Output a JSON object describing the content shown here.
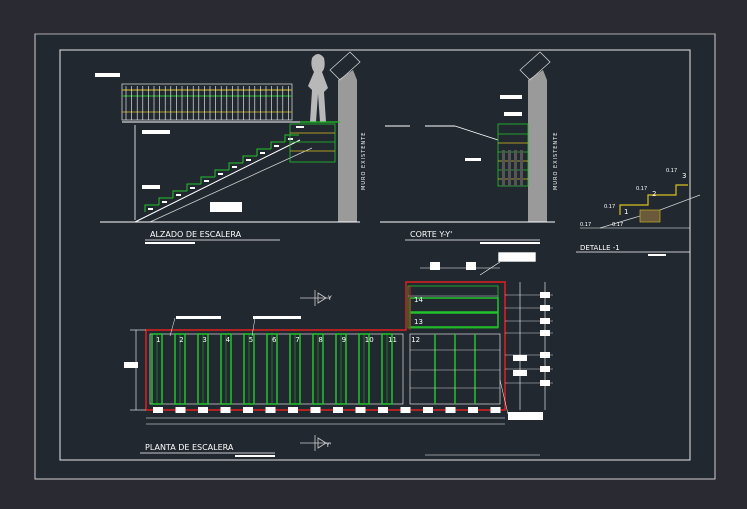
{
  "colors": {
    "background": "#2a2a33",
    "sheet": "#212830",
    "red": "#e0201c",
    "green": "#22c22a",
    "white": "#ffffff",
    "grey": "#8a8a8a",
    "yellow": "#d8c020"
  },
  "titles": {
    "alzado": "ALZADO DE ESCALERA",
    "corte": "CORTE Y-Y'",
    "detalle": "DETALLE -1",
    "planta": "PLANTA DE ESCALERA"
  },
  "wall_label": "MURO EXISTENTE",
  "section_marks": {
    "top": "Y",
    "bottom": "Y'"
  },
  "detail_dims": [
    "0.17",
    "0.17",
    "0.17",
    "0.17",
    "0.17"
  ],
  "detail_steps": [
    "1",
    "2",
    "3"
  ],
  "step_numbers": [
    "1",
    "2",
    "3",
    "4",
    "5",
    "6",
    "7",
    "8",
    "9",
    "10",
    "11",
    "12",
    "13",
    "14"
  ]
}
